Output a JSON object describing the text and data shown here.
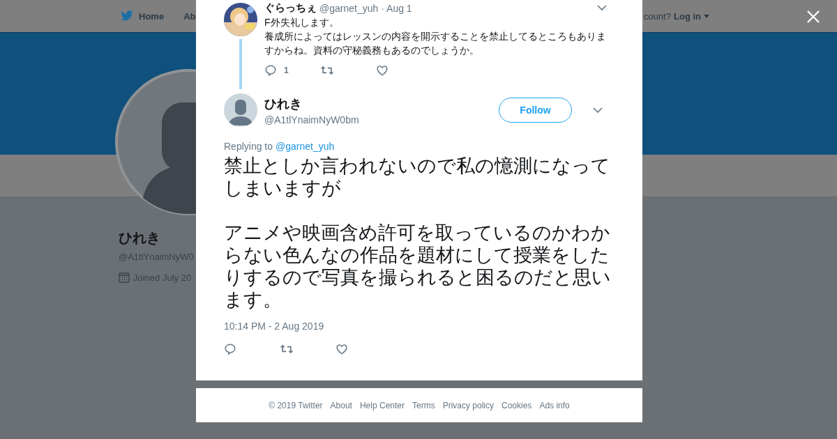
{
  "nav": {
    "home": "Home",
    "about": "Ab",
    "account_prompt": "count?",
    "login": "Log in"
  },
  "profile": {
    "name": "ひれき",
    "handle": "@A1tlYnaimNyW0",
    "joined": "Joined July 20"
  },
  "parent_tweet": {
    "name": "ぐらっちぇ",
    "handle": "@garnet_yuh",
    "date": "· Aug 1",
    "text": [
      "F外失礼します。",
      "養成所によってはレッスンの内容を開示することを禁止してるところもありますからね。資料の守秘義務もあるのでしょうか。"
    ],
    "reply_count": "1"
  },
  "tweet": {
    "name": "ひれき",
    "handle": "@A1tlYnaimNyW0bm",
    "follow": "Follow",
    "replying_prefix": "Replying to",
    "replying_to": "@garnet_yuh",
    "text": [
      "禁止としか言われないので私の憶測になってしまいますが",
      "アニメや映画含め許可を取っているのかわからない色んなの作品を題材にして授業をしたりするので写真を撮られると困るのだと思います。"
    ],
    "timestamp": "10:14 PM - 2 Aug 2019"
  },
  "footer": [
    "© 2019 Twitter",
    "About",
    "Help Center",
    "Terms",
    "Privacy policy",
    "Cookies",
    "Ads info"
  ]
}
